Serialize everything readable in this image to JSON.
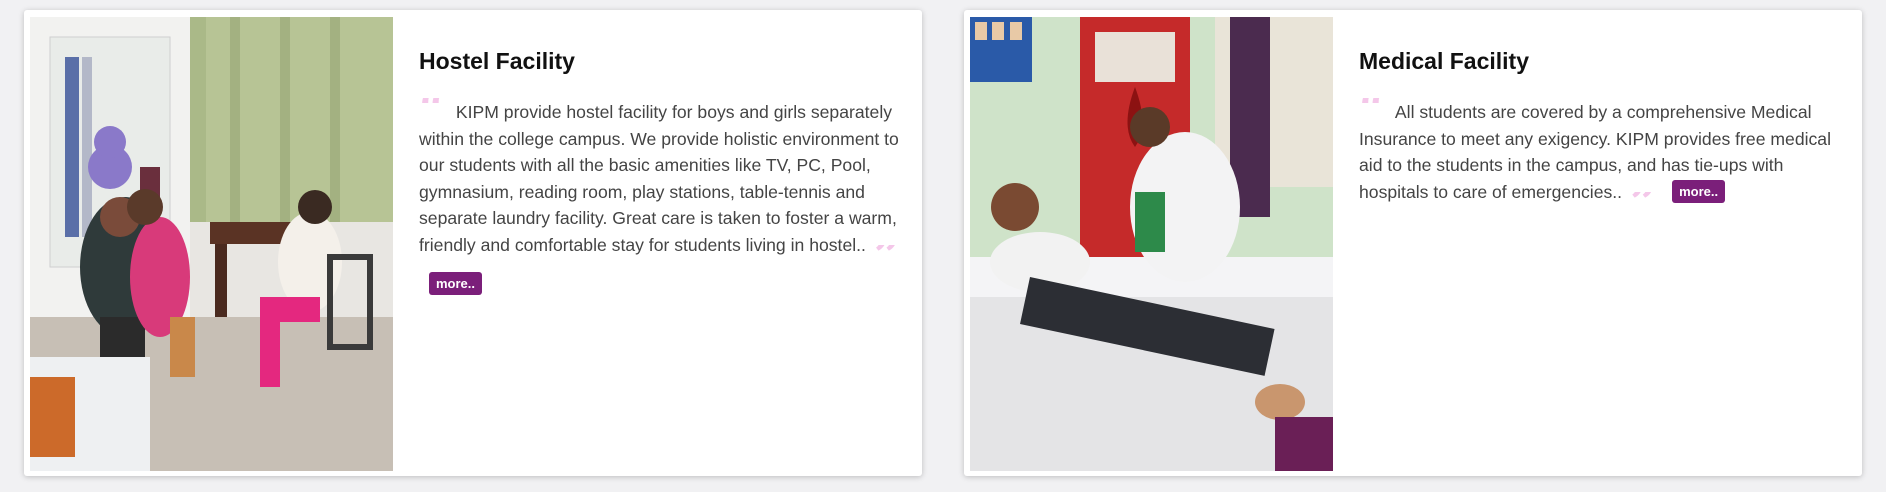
{
  "cards": [
    {
      "title": "Hostel Facility",
      "image_alt": "students-in-hostel-room",
      "body": "KIPM provide hostel facility for boys and girls separately within the college campus. We provide holistic environment to our students with all the basic amenities like TV, PC, Pool, gymnasium, reading room, play stations, table-tennis and separate laundry facility. Great care is taken to foster a warm, friendly and comfortable stay for students living in hostel..",
      "more_label": "more.."
    },
    {
      "title": "Medical Facility",
      "image_alt": "student-at-medical-camp",
      "body": "All students are covered by a comprehensive Medical Insurance to meet any exigency. KIPM provides free medical aid to the students in the campus, and has tie-ups with hospitals to care of emergencies..",
      "more_label": "more.."
    }
  ],
  "quote_open": "“",
  "quote_close": "”",
  "colors": {
    "accent": "#7b1f7a",
    "quote_pink": "#f4c7e9",
    "page_bg": "#f1f1f3",
    "title": "#111111",
    "body": "#444444"
  }
}
